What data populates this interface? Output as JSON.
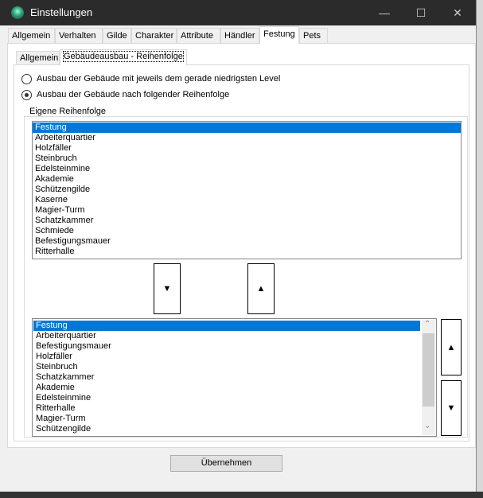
{
  "window": {
    "title": "Einstellungen",
    "minimize": "—",
    "maximize": "☐",
    "close": "✕"
  },
  "tabs": [
    "Allgemein",
    "Verhalten",
    "Gilde",
    "Charakter",
    "Attribute",
    "Händler",
    "Festung",
    "Pets"
  ],
  "active_tab": "Festung",
  "subtabs": [
    "Allgemein",
    "Gebäudeausbau - Reihenfolge"
  ],
  "active_subtab": "Gebäudeausbau - Reihenfolge",
  "radios": [
    {
      "label": "Ausbau der Gebäude mit jeweils dem gerade niedrigsten Level",
      "checked": false
    },
    {
      "label": "Ausbau der Gebäude nach folgender Reihenfolge",
      "checked": true
    }
  ],
  "group_label": "Eigene Reihenfolge",
  "list_available": [
    "Festung",
    "Arbeiterquartier",
    "Holzfäller",
    "Steinbruch",
    "Edelsteinmine",
    "Akademie",
    "Schützengilde",
    "Kaserne",
    "Magier-Turm",
    "Schatzkammer",
    "Schmiede",
    "Befestigungsmauer",
    "Ritterhalle"
  ],
  "list_order": [
    "Festung",
    "Arbeiterquartier",
    "Befestigungsmauer",
    "Holzfäller",
    "Steinbruch",
    "Schatzkammer",
    "Akademie",
    "Edelsteinmine",
    "Ritterhalle",
    "Magier-Turm",
    "Schützengilde"
  ],
  "buttons": {
    "add_down": "▼",
    "remove_up": "▲",
    "move_up": "▲",
    "move_down": "▼",
    "apply": "Übernehmen",
    "scroll_up": "⌃",
    "scroll_down": "⌄"
  },
  "colors": {
    "selection": "#0078d7",
    "titlebar": "#2b2b2b"
  }
}
